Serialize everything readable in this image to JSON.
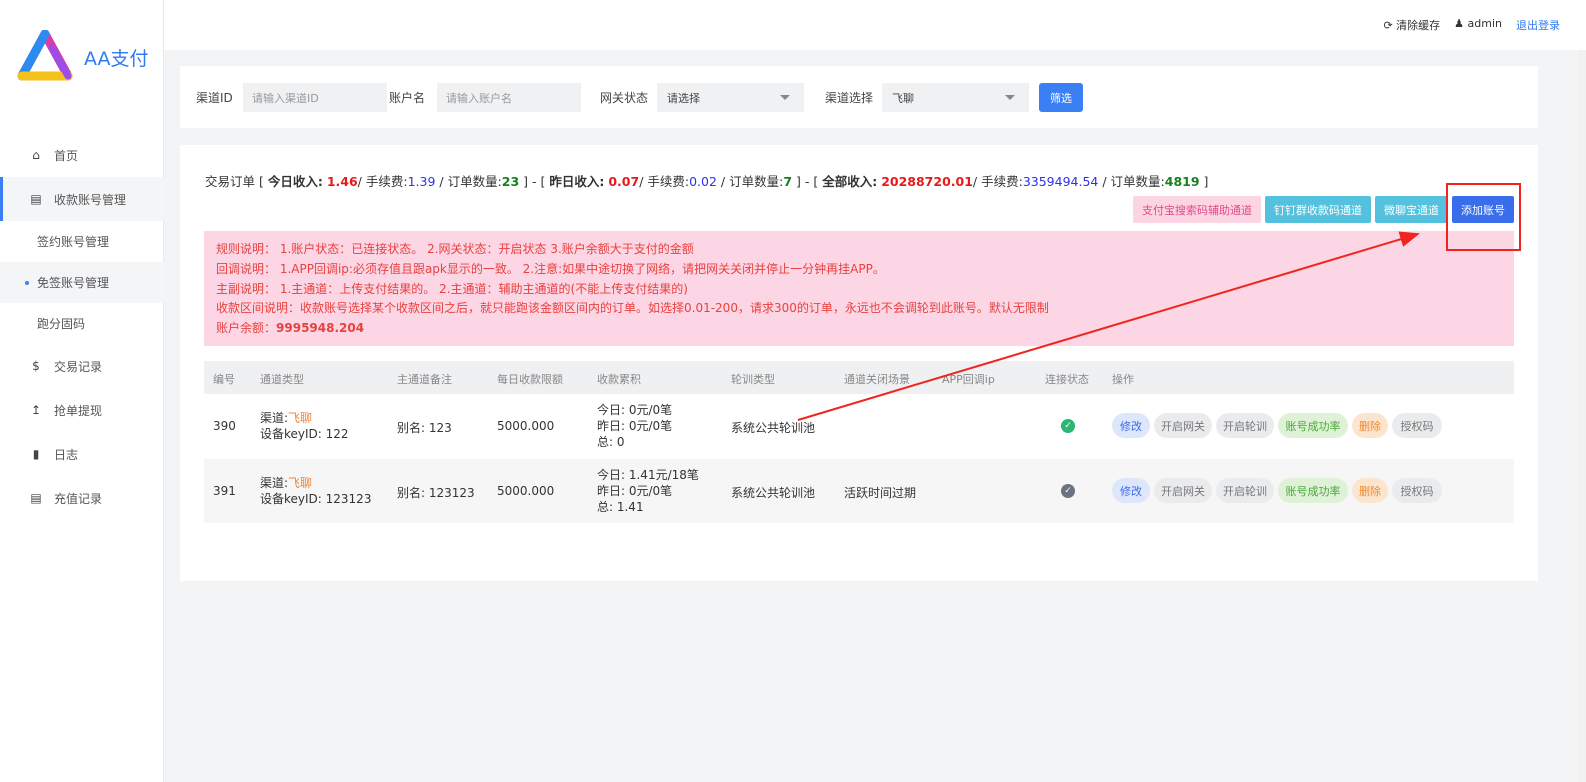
{
  "app": {
    "name": "AA支付"
  },
  "topbar": {
    "clear_cache": "清除缓存",
    "user": "admin",
    "logout": "退出登录"
  },
  "sidebar": {
    "items": [
      {
        "label": "首页",
        "icon": "home-icon"
      },
      {
        "label": "收款账号管理",
        "icon": "list-icon"
      },
      {
        "label": "签约账号管理"
      },
      {
        "label": "免签账号管理"
      },
      {
        "label": "跑分固码"
      },
      {
        "label": "交易记录",
        "icon": "dollar-icon"
      },
      {
        "label": "抢单提现",
        "icon": "upload-icon"
      },
      {
        "label": "日志",
        "icon": "book-icon"
      },
      {
        "label": "充值记录",
        "icon": "list-icon"
      }
    ]
  },
  "filter": {
    "channel_id_label": "渠道ID",
    "channel_id_placeholder": "请输入渠道ID",
    "account_label": "账户名",
    "account_placeholder": "请输入账户名",
    "gateway_label": "网关状态",
    "gateway_value": "请选择",
    "channel_select_label": "渠道选择",
    "channel_select_value": "飞聊",
    "submit": "筛选"
  },
  "stats": {
    "prefix": "交易订单 [",
    "today_label": "今日收入:",
    "today_income": "1.46",
    "today_fee_label": "/ 手续费:",
    "today_fee": "1.39",
    "today_count_label": " / 订单数量:",
    "today_count": "23",
    "sep1": " ] - [",
    "yesterday_label": "昨日收入:",
    "yesterday_income": "0.07",
    "yesterday_fee_label": "/ 手续费:",
    "yesterday_fee": "0.02",
    "yesterday_count_label": " / 订单数量:",
    "yesterday_count": "7",
    "sep2": " ] - [",
    "total_label": "全部收入:",
    "total_income": "20288720.01",
    "total_fee_label": "/ 手续费:",
    "total_fee": "3359494.54",
    "total_count_label": " / 订单数量:",
    "total_count": "4819",
    "suffix": " ]"
  },
  "actions": {
    "alipay_aux": "支付宝搜索码辅助通道",
    "dingtalk": "钉钉群收款码通道",
    "weibo": "微聊宝通道",
    "add_account": "添加账号"
  },
  "notice": {
    "line1": "规则说明： 1.账户状态：已连接状态。 2.网关状态：开启状态 3.账户余额大于支付的金额",
    "line2": "回调说明： 1.APP回调ip:必须存值且跟apk显示的一致。 2.注意:如果中途切换了网络，请把网关关闭并停止一分钟再挂APP。",
    "line3": "主副说明： 1.主通道：上传支付结果的。 2.主通道：辅助主通道的(不能上传支付结果的)",
    "line4": "收款区间说明：收款账号选择某个收款区间之后，就只能跑该金额区间内的订单。如选择0.01-200，请求300的订单，永远也不会调轮到此账号。默认无限制",
    "balance_label": "账户余额：",
    "balance": "9995948.204"
  },
  "table": {
    "headers": [
      "编号",
      "通道类型",
      "主通道备注",
      "每日收款限额",
      "收款累积",
      "轮训类型",
      "通道关闭场景",
      "APP回调ip",
      "连接状态",
      "操作"
    ],
    "rows": [
      {
        "id": "390",
        "channel_label": "渠道:",
        "channel": "飞聊",
        "device": "设备keyID: 122",
        "remark": "别名: 123",
        "limit": "5000.000",
        "acc_today": "今日: 0元/0笔",
        "acc_yesterday": "昨日: 0元/0笔",
        "acc_total": "总: 0",
        "poll_type": "系统公共轮训池",
        "close_scene": "",
        "callback_ip": "",
        "status_color": "#2bb673",
        "ops": [
          "修改",
          "开启网关",
          "开启轮训",
          "账号成功率",
          "删除",
          "授权码"
        ]
      },
      {
        "id": "391",
        "channel_label": "渠道:",
        "channel": "飞聊",
        "device": "设备keyID: 123123",
        "remark": "别名: 123123",
        "limit": "5000.000",
        "acc_today": "今日: 1.41元/18笔",
        "acc_yesterday": "昨日: 0元/0笔",
        "acc_total": "总: 1.41",
        "poll_type": "系统公共轮训池",
        "close_scene": "活跃时间过期",
        "callback_ip": "",
        "status_color": "#6b7380",
        "ops": [
          "修改",
          "开启网关",
          "开启轮训",
          "账号成功率",
          "删除",
          "授权码"
        ]
      }
    ]
  },
  "colors": {
    "accent": "#3a80f4",
    "danger": "#e8191b",
    "annotation": "#f0251f"
  }
}
